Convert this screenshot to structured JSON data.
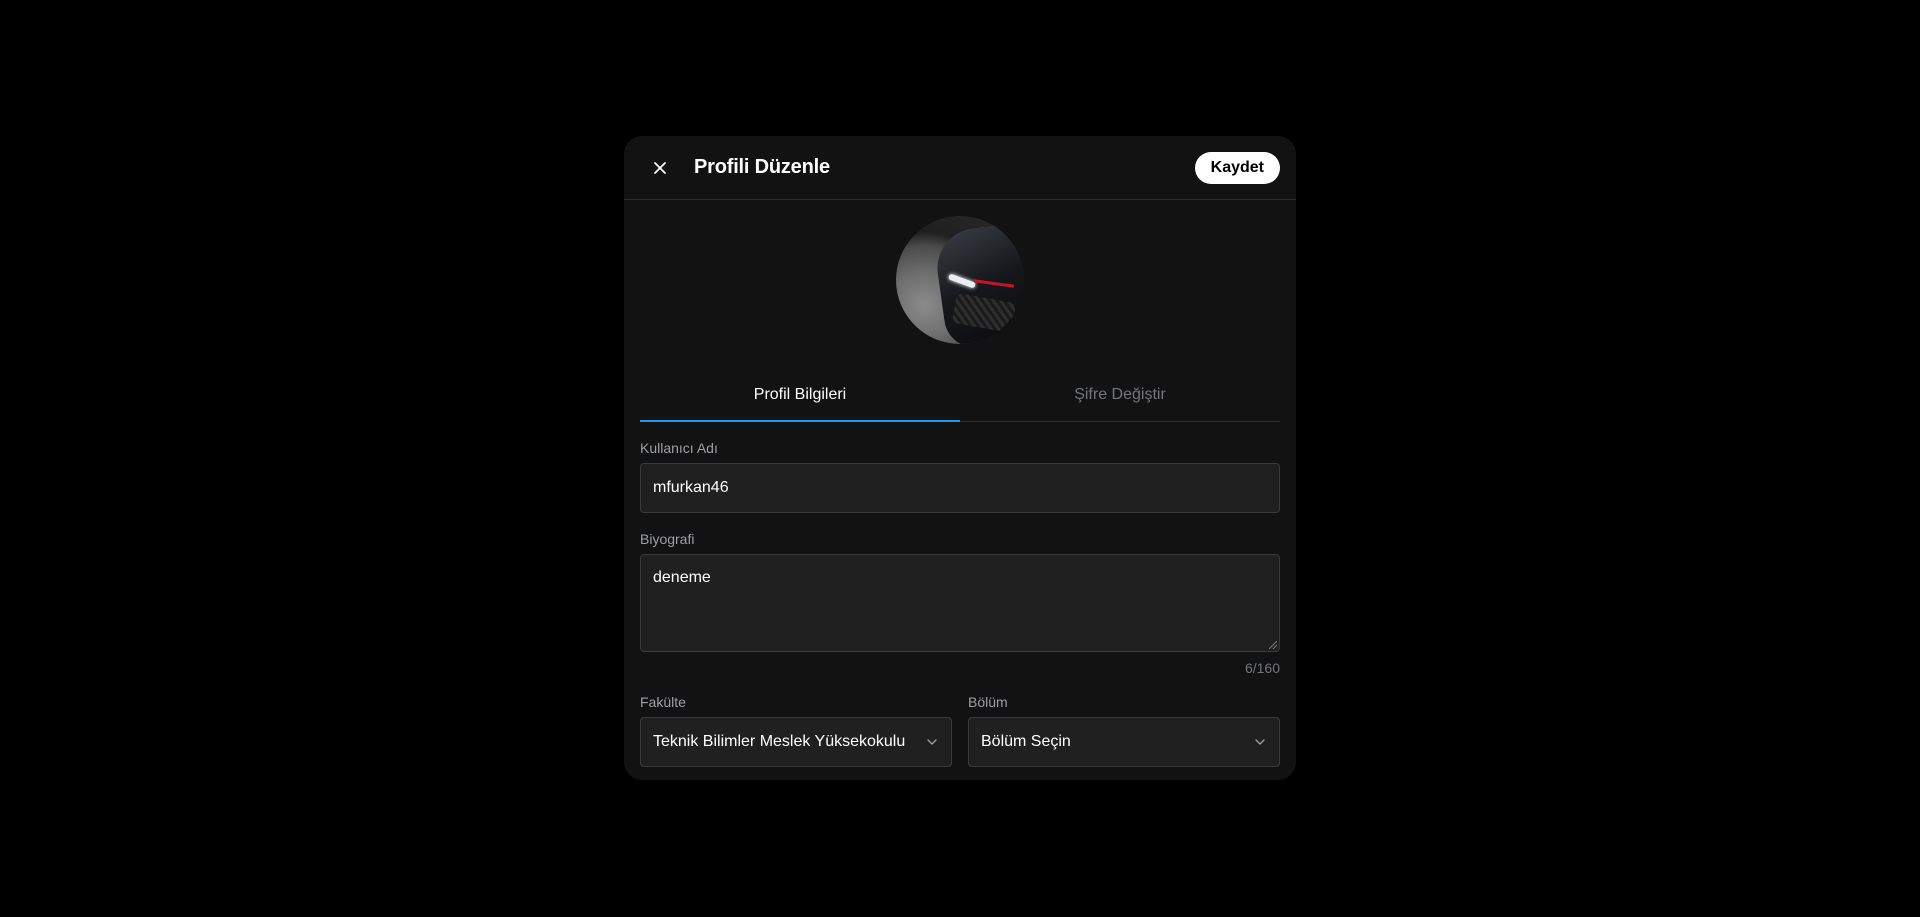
{
  "modal": {
    "title": "Profili Düzenle",
    "save_label": "Kaydet"
  },
  "tabs": [
    {
      "label": "Profil Bilgileri",
      "active": true
    },
    {
      "label": "Şifre Değiştir",
      "active": false
    }
  ],
  "form": {
    "username": {
      "label": "Kullanıcı Adı",
      "value": "mfurkan46"
    },
    "bio": {
      "label": "Biyografi",
      "value": "deneme",
      "counter": "6/160"
    },
    "faculty": {
      "label": "Fakülte",
      "value": "Teknik Bilimler Meslek Yüksekokulu"
    },
    "department": {
      "label": "Bölüm",
      "value": "Bölüm Seçin"
    }
  },
  "icons": {
    "close": "close-icon",
    "chevron": "chevron-down-icon"
  },
  "colors": {
    "background": "#000000",
    "modal": "#121212",
    "accent": "#1d9bf0",
    "input_bg": "#202020"
  }
}
